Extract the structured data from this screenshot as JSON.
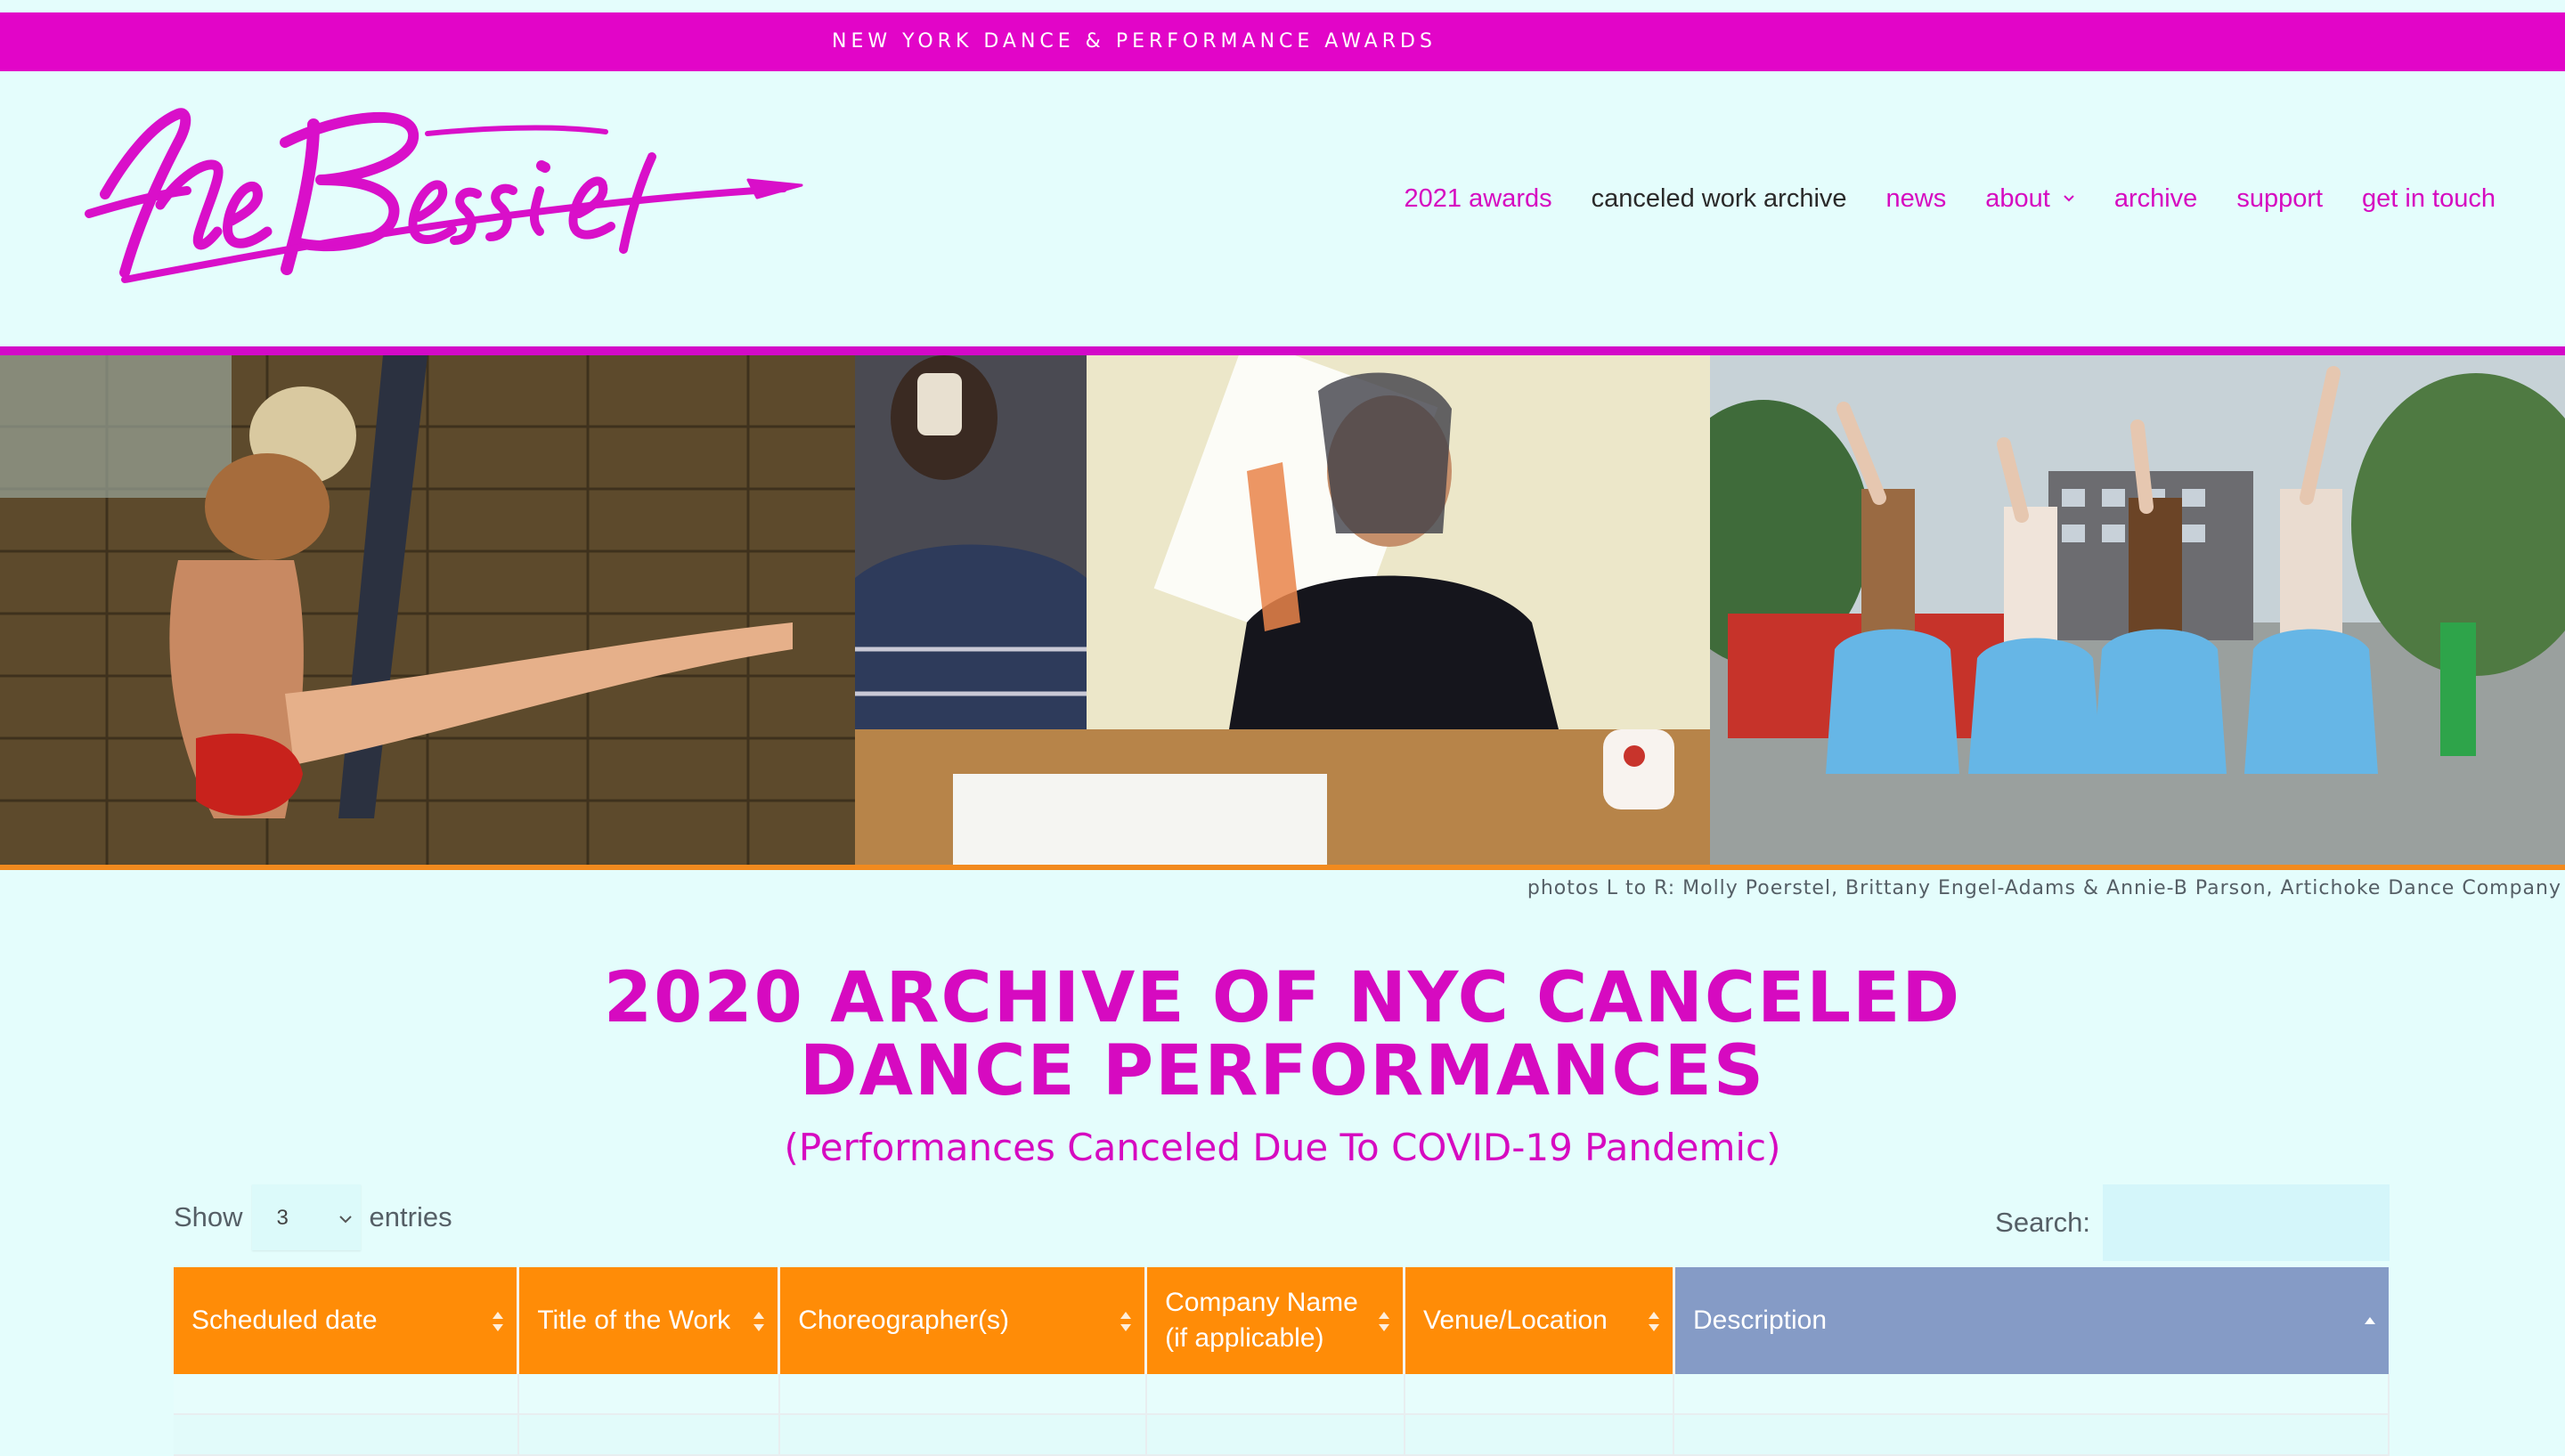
{
  "site": {
    "tagline": "NEW YORK DANCE & PERFORMANCE AWARDS",
    "logo_text": "the Bessies"
  },
  "nav": {
    "items": [
      {
        "label": "2021 awards"
      },
      {
        "label": "canceled work archive",
        "active": true
      },
      {
        "label": "news"
      },
      {
        "label": "about",
        "has_dropdown": true
      },
      {
        "label": "archive"
      },
      {
        "label": "support"
      },
      {
        "label": "get in touch"
      }
    ]
  },
  "hero": {
    "caption": "photos L to R: Molly Poerstel, Brittany Engel-Adams & Annie-B Parson, Artichoke Dance Company"
  },
  "main": {
    "title_line1": "2020 Archive of NYC Canceled",
    "title_line2": "Dance Performances",
    "subtitle": "(Performances Canceled Due To COVID-19 Pandemic)"
  },
  "table_controls": {
    "show_label": "Show",
    "entries_value": "3",
    "entries_label": "entries",
    "search_label": "Search:",
    "search_value": ""
  },
  "table": {
    "columns": [
      {
        "label": "Scheduled date"
      },
      {
        "label": "Title of the Work"
      },
      {
        "label": "Choreographer(s)"
      },
      {
        "label": "Company Name (if applicable)"
      },
      {
        "label": "Venue/Location"
      },
      {
        "label": "Description",
        "sorted": "asc"
      }
    ]
  },
  "colors": {
    "brand_magenta": "#d60ac0",
    "header_orange": "#ff8c07",
    "sorted_header": "#859bc6",
    "page_background": "#e4fdfc"
  }
}
